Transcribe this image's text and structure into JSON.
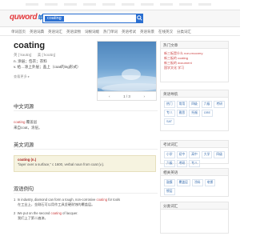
{
  "header": {
    "logo_main": "quword",
    "logo_sub": "单词",
    "search_chip": "coating"
  },
  "nav": {
    "items": [
      "单词首页",
      "英语词典",
      "英语词汇",
      "英语读物",
      "词根词缀",
      "热门单词",
      "英语考试",
      "英语背景",
      "在线英汉",
      "分类词汇"
    ]
  },
  "word": {
    "title": "coating",
    "phon_uk": "英 [ˈkəʊtɪŋ]",
    "phon_us": "美 [ˈkoʊtɪŋ]",
    "defs": [
      "n. 涂层；包衣；衣料",
      "v. 给…涂上外层；盖上（coat的ing形式）"
    ],
    "more": "查看更多 ▸"
  },
  "photo": {
    "pager": "1 / 3",
    "prev": "‹",
    "next": "›"
  },
  "sections": {
    "chinese_title": "中文词源",
    "chinese_body_hl": "coating",
    "chinese_body_rest": " 覆盖层",
    "chinese_body_2": "来自coat，涂层。",
    "english_title": "英文词源",
    "english_box_title": "coating (n.)",
    "english_box_body": "\"layer over a surface,\" c 1600, verbal noun from coat (v.).",
    "examples_title": "双语例句"
  },
  "examples": [
    {
      "num": "1",
      "pre": "In industry, diamond can form a tough, non-corrosive ",
      "hl": "coating",
      "post": " for tools",
      "cn": "在工业上，金刚石可以用作工具坚硬耐蚀的覆盖层。"
    },
    {
      "num": "2",
      "pre": "We put on the second ",
      "hl": "coating",
      "post": " of lacquer.",
      "cn": "我们上了第二遍漆。"
    }
  ],
  "sidebar": {
    "hot_title": "热门文章",
    "hot_items": [
      "新三板是什么 non-recovery",
      "新三板的 coating",
      "新三板的 document",
      "国学文化 学习"
    ],
    "nav_title": "英语导航",
    "nav_tags": [
      "热门",
      "常用",
      "四级",
      "六级",
      "考研",
      "专八",
      "雅思",
      "托福",
      "GRE",
      "SAT"
    ],
    "exam_title": "考试词汇",
    "exam_tags": [
      "小学",
      "初中",
      "高中",
      "大学",
      "四级",
      "六级",
      "考研",
      "专八"
    ],
    "related_title": "相关英语",
    "related_tags": [
      "鼓膜",
      "覆盖层",
      "涂料",
      "电镀",
      "镀层"
    ],
    "cat_title": "分类词汇"
  }
}
